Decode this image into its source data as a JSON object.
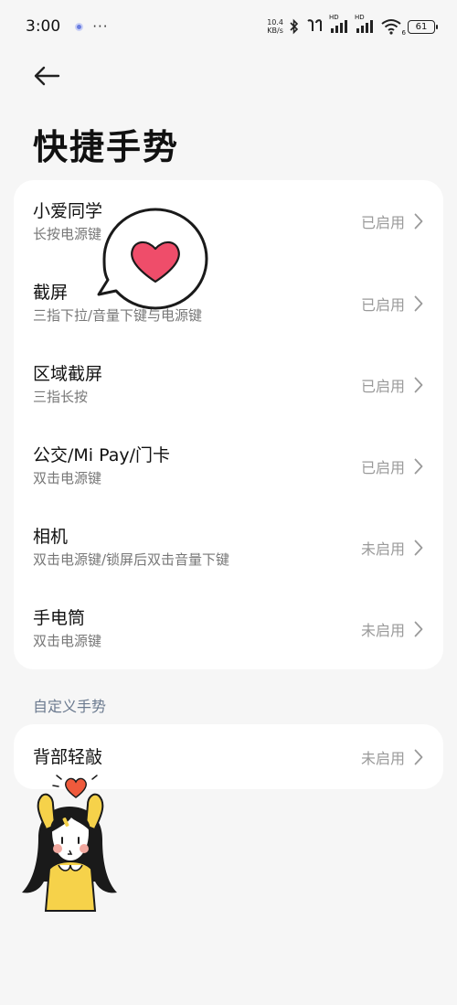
{
  "status_bar": {
    "time": "3:00",
    "more": "···",
    "net_speed_value": "10.4",
    "net_speed_unit": "KB/s",
    "signal1_label": "HD",
    "signal2_label": "HD",
    "wifi_sub": "6",
    "battery": "61"
  },
  "page": {
    "title": "快捷手势"
  },
  "gestures": [
    {
      "title": "小爱同学",
      "subtitle": "长按电源键",
      "status": "已启用"
    },
    {
      "title": "截屏",
      "subtitle": "三指下拉/音量下键与电源键",
      "status": "已启用"
    },
    {
      "title": "区域截屏",
      "subtitle": "三指长按",
      "status": "已启用"
    },
    {
      "title": "公交/Mi Pay/门卡",
      "subtitle": "双击电源键",
      "status": "已启用"
    },
    {
      "title": "相机",
      "subtitle": "双击电源键/锁屏后双击音量下键",
      "status": "未启用"
    },
    {
      "title": "手电筒",
      "subtitle": "双击电源键",
      "status": "未启用"
    }
  ],
  "custom_section": {
    "label": "自定义手势",
    "items": [
      {
        "title": "背部轻敲",
        "status": "未启用"
      }
    ]
  },
  "colors": {
    "background": "#f6f6f6",
    "card": "#ffffff",
    "section_label": "#6b7a8f",
    "status_text": "#9a9a9a",
    "heart": "#ef4d6a"
  },
  "icons": {
    "back": "arrow-left-icon",
    "chevron": "chevron-right-icon",
    "bluetooth": "bluetooth-icon",
    "earbuds": "earbuds-icon",
    "signal": "signal-bars-icon",
    "wifi": "wifi-icon",
    "battery": "battery-icon"
  }
}
